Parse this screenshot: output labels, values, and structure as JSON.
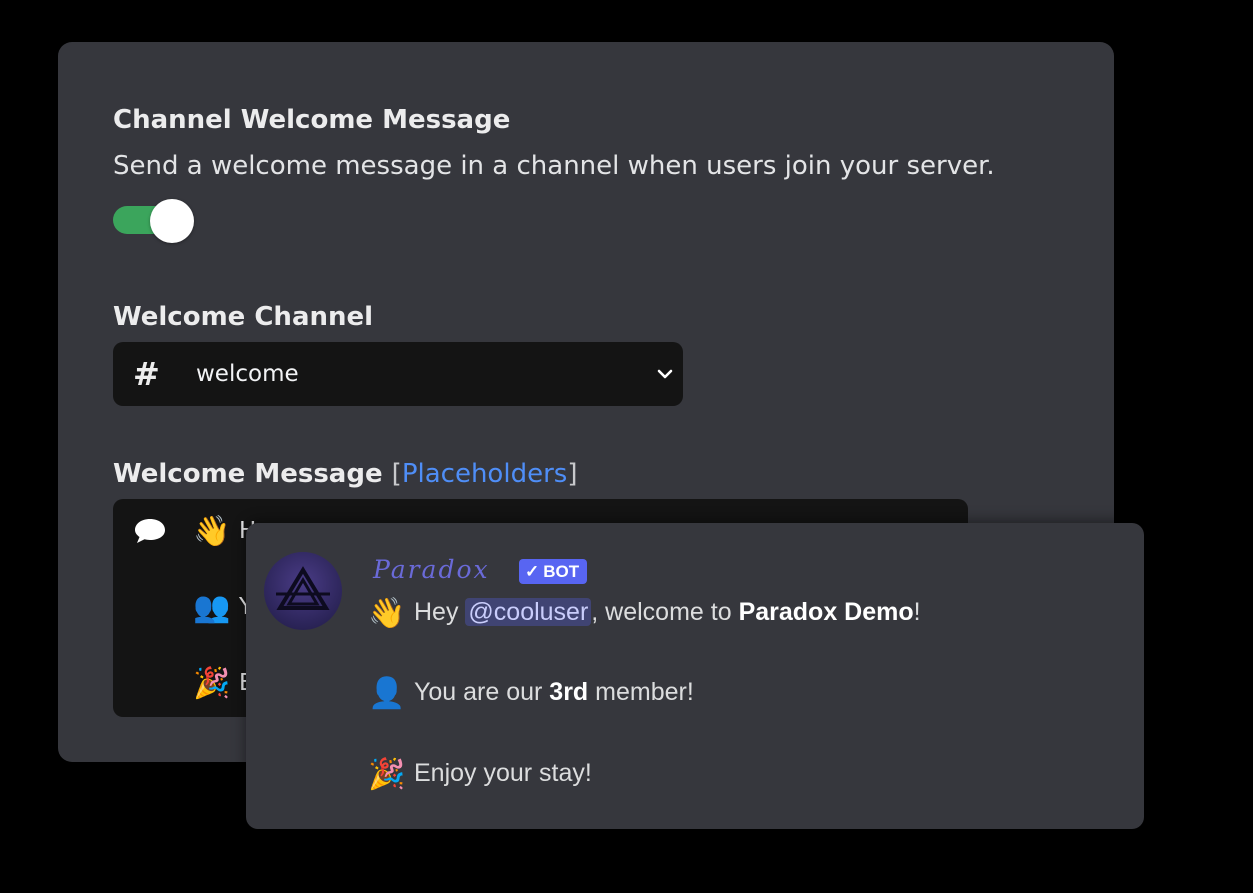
{
  "settings": {
    "welcome_message": {
      "title": "Channel Welcome Message",
      "description": "Send a welcome message in a channel when users join your server.",
      "enabled": true,
      "accent_color": "#3ba55c"
    },
    "welcome_channel": {
      "title": "Welcome Channel",
      "hash_symbol": "#",
      "selected": "welcome"
    },
    "welcome_text": {
      "title": "Welcome Message",
      "bracket_open": "[",
      "placeholders_link": "Placeholders",
      "bracket_close": "]",
      "lines": [
        {
          "emoji": "👋",
          "text": "H"
        },
        {
          "emoji": "👥",
          "text": "Y"
        },
        {
          "emoji": "🎉",
          "text": "E"
        }
      ]
    }
  },
  "preview": {
    "username": "Paradox",
    "badge": "BOT",
    "badge_check": "✓",
    "badge_color": "#5865f2",
    "line1": {
      "emoji": "👋",
      "prefix": "Hey ",
      "mention": "@cooluser",
      "middle": ", welcome to ",
      "server": "Paradox Demo",
      "suffix": "!"
    },
    "line2": {
      "emoji": "👤",
      "prefix": "You are our ",
      "count": "3rd",
      "suffix": " member!"
    },
    "line3": {
      "emoji": "🎉",
      "text": "Enjoy your stay!"
    }
  }
}
